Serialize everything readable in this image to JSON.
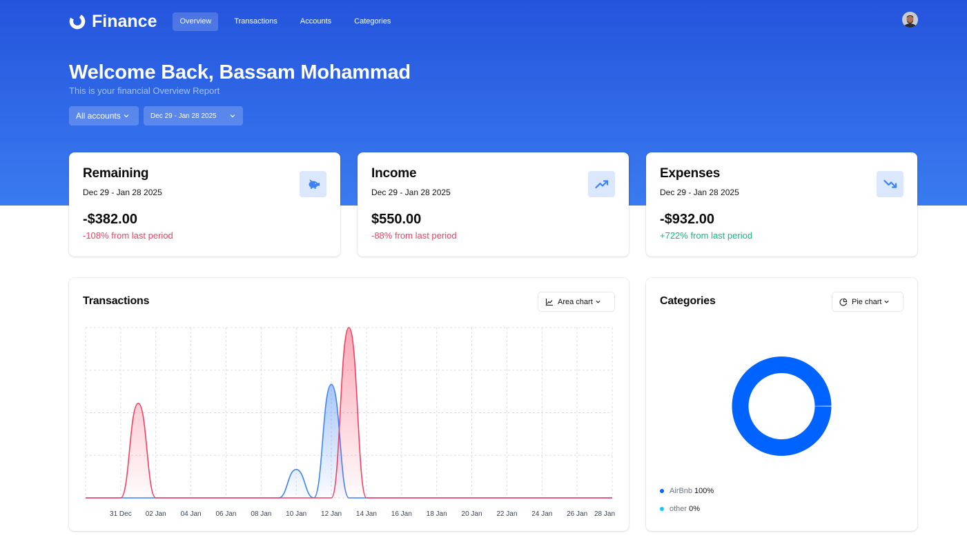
{
  "app": {
    "name": "Finance",
    "nav": [
      "Overview",
      "Transactions",
      "Accounts",
      "Categories"
    ],
    "active_nav": "Overview"
  },
  "header": {
    "welcome": "Welcome Back, Bassam Mohammad",
    "subtitle": "This is your financial Overview Report",
    "account_filter": "All accounts",
    "date_filter": "Dec 29 - Jan 28 2025"
  },
  "stats": [
    {
      "title": "Remaining",
      "range": "Dec 29 - Jan 28 2025",
      "value": "-$382.00",
      "change": "-108% from last period",
      "change_color": "#f43f5e",
      "icon": "piggy-bank-icon"
    },
    {
      "title": "Income",
      "range": "Dec 29 - Jan 28 2025",
      "value": "$550.00",
      "change": "-88% from last period",
      "change_color": "#f43f5e",
      "icon": "trending-up-icon"
    },
    {
      "title": "Expenses",
      "range": "Dec 29 - Jan 28 2025",
      "value": "-$932.00",
      "change": "+722% from last period",
      "change_color": "#10b981",
      "icon": "trending-down-icon"
    }
  ],
  "transactions_panel": {
    "title": "Transactions",
    "chart_selector": "Area chart"
  },
  "categories_panel": {
    "title": "Categories",
    "chart_selector": "Pie chart"
  },
  "chart_data": [
    {
      "type": "area",
      "x_ticks": [
        "31 Dec",
        "02 Jan",
        "04 Jan",
        "06 Jan",
        "08 Jan",
        "10 Jan",
        "12 Jan",
        "14 Jan",
        "16 Jan",
        "18 Jan",
        "20 Jan",
        "22 Jan",
        "24 Jan",
        "26 Jan",
        "28 Jan"
      ],
      "x": [
        "29 Dec",
        "30 Dec",
        "31 Dec",
        "01 Jan",
        "02 Jan",
        "03 Jan",
        "04 Jan",
        "05 Jan",
        "06 Jan",
        "07 Jan",
        "08 Jan",
        "09 Jan",
        "10 Jan",
        "11 Jan",
        "12 Jan",
        "13 Jan",
        "14 Jan",
        "15 Jan",
        "16 Jan",
        "17 Jan",
        "18 Jan",
        "19 Jan",
        "20 Jan",
        "21 Jan",
        "22 Jan",
        "23 Jan",
        "24 Jan",
        "25 Jan",
        "26 Jan",
        "27 Jan",
        "28 Jan"
      ],
      "series": [
        {
          "color": "#3b82f6",
          "values": [
            0,
            0,
            0,
            0,
            0,
            0,
            0,
            0,
            0,
            0,
            0,
            0,
            75,
            0,
            300,
            0,
            0,
            0,
            0,
            0,
            0,
            0,
            0,
            0,
            0,
            0,
            0,
            0,
            0,
            0,
            0
          ]
        },
        {
          "color": "#f43f5e",
          "values": [
            0,
            0,
            0,
            250,
            0,
            0,
            0,
            0,
            0,
            0,
            0,
            0,
            0,
            0,
            0,
            450,
            0,
            0,
            0,
            0,
            0,
            0,
            0,
            0,
            0,
            0,
            0,
            0,
            0,
            0,
            0
          ]
        }
      ],
      "ylim": [
        0,
        450
      ],
      "grid": true
    },
    {
      "type": "pie",
      "labels": [
        "AirBnb",
        "other"
      ],
      "values": [
        100,
        0
      ],
      "display": [
        "100%",
        "0%"
      ],
      "colors": [
        "#0062ff",
        "#12c6ff"
      ]
    }
  ]
}
